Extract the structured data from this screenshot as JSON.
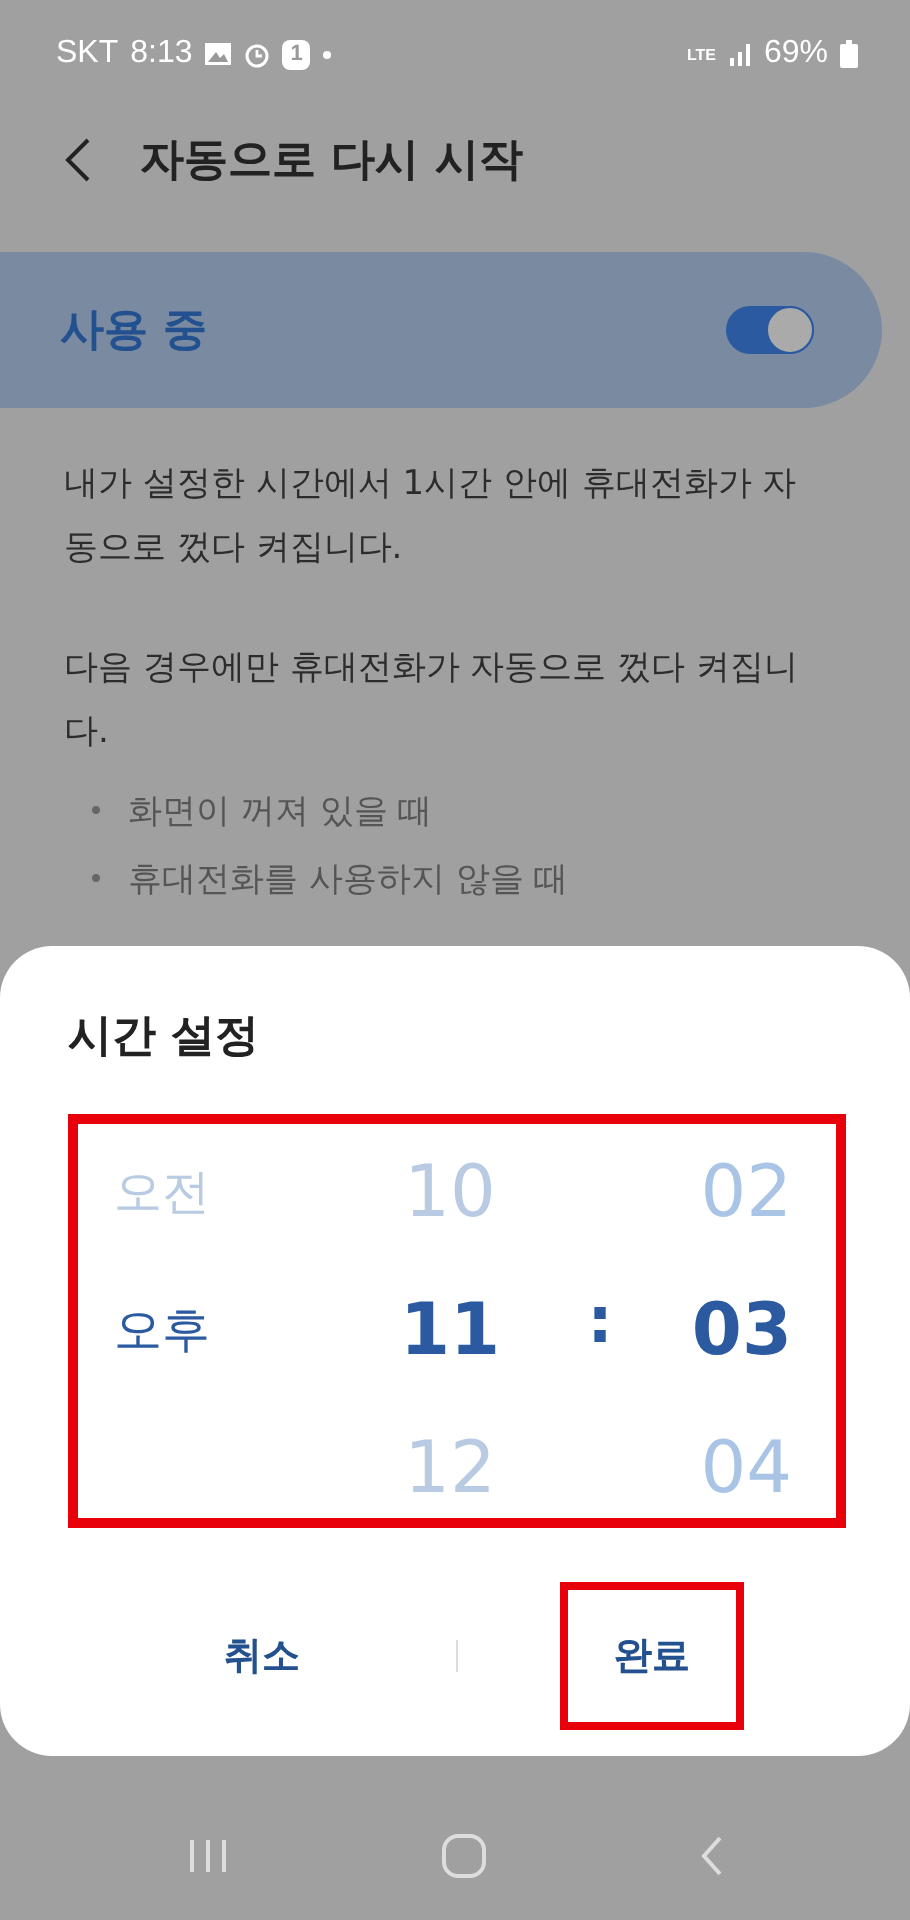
{
  "status_bar": {
    "carrier": "SKT",
    "time": "8:13",
    "notification_count": "1",
    "network": "LTE",
    "battery": "69%"
  },
  "header": {
    "title": "자동으로 다시 시작"
  },
  "master_switch": {
    "label": "사용 중",
    "on": true
  },
  "description": [
    "내가 설정한 시간에서 1시간 안에 휴대전화가 자동으로 껐다 켜집니다.",
    "다음 경우에만 휴대전화가 자동으로 껐다 켜집니다."
  ],
  "conditions": [
    "화면이 꺼져 있을 때",
    "휴대전화를 사용하지 않을 때"
  ],
  "dialog": {
    "title": "시간 설정",
    "highlighted": true,
    "columns": [
      {
        "kind": "ampm",
        "items": [
          {
            "text": "오전",
            "selected": false
          },
          {
            "text": "오후",
            "selected": true
          }
        ]
      },
      {
        "kind": "hour",
        "items": [
          {
            "text": "10",
            "selected": false
          },
          {
            "text": "11",
            "selected": true
          },
          {
            "text": "12",
            "selected": false
          }
        ]
      },
      {
        "kind": "separator",
        "items": [
          {
            "text": ":",
            "selected": true
          }
        ]
      },
      {
        "kind": "minute",
        "items": [
          {
            "text": "02",
            "selected": false
          },
          {
            "text": "03",
            "selected": true
          },
          {
            "text": "04",
            "selected": false
          }
        ]
      }
    ],
    "buttons": [
      {
        "label": "취소",
        "highlighted": false
      },
      {
        "label": "완료",
        "highlighted": true
      }
    ]
  }
}
